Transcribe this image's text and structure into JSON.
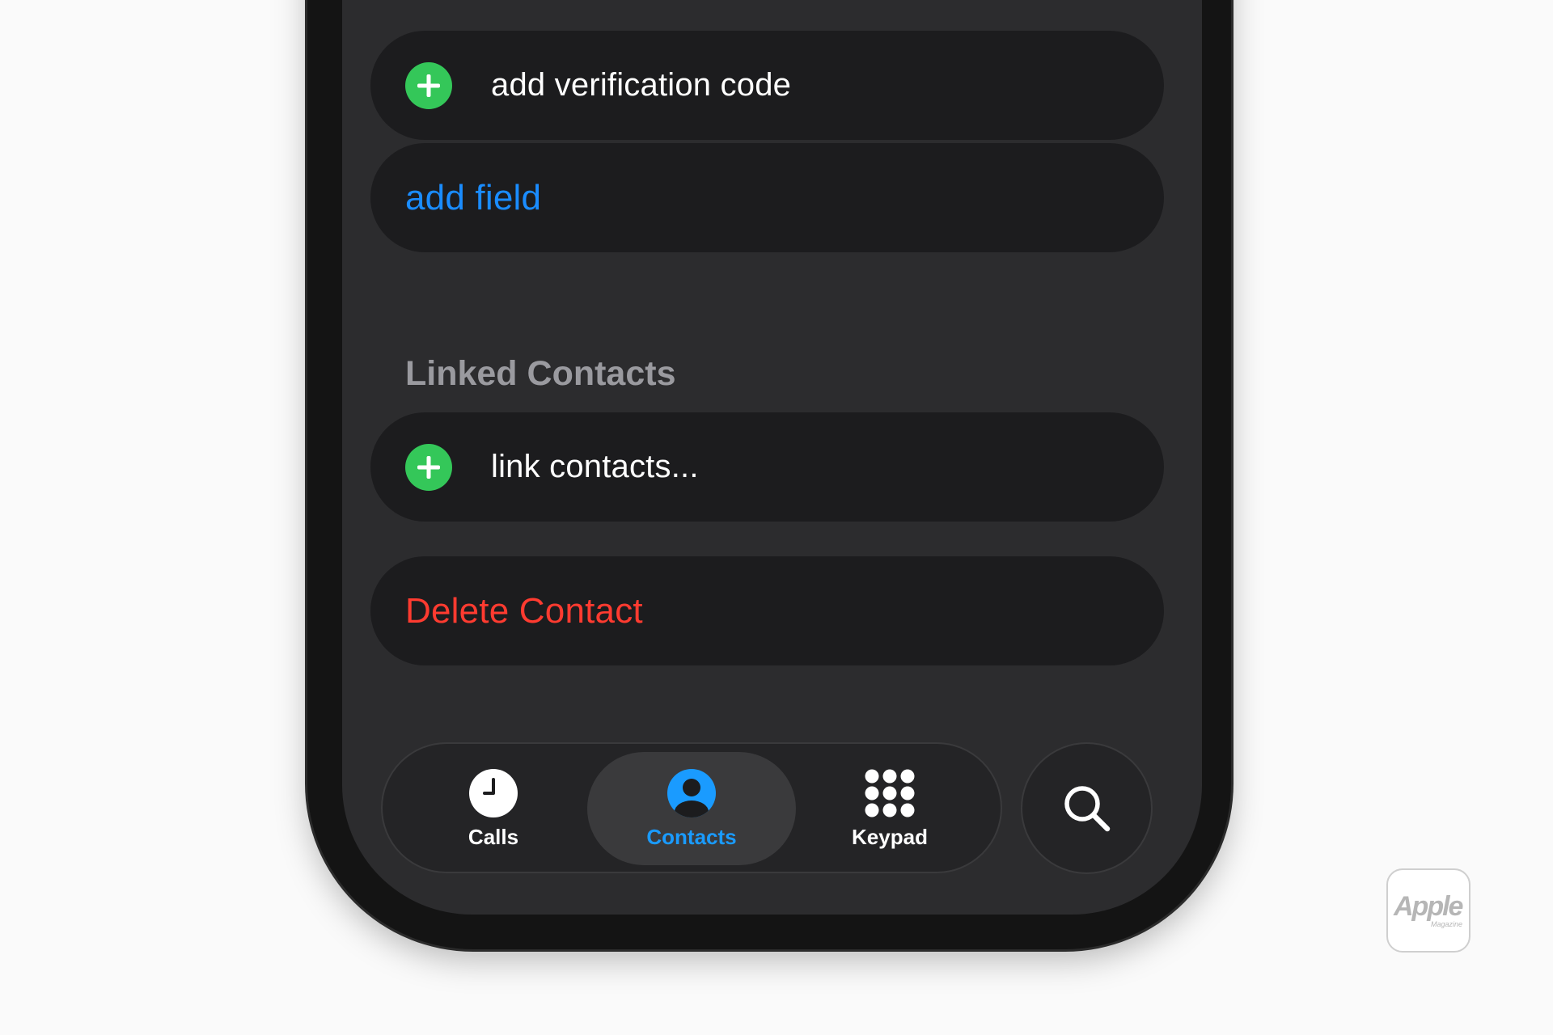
{
  "rows": {
    "verification": {
      "label": "add verification code",
      "icon": "plus-circle-icon"
    },
    "add_field": {
      "label": "add field",
      "color": "#1a8cff"
    },
    "linked_contacts_header": "Linked Contacts",
    "link_contacts": {
      "label": "link contacts...",
      "icon": "plus-circle-icon"
    },
    "delete_contact": {
      "label": "Delete Contact",
      "color": "#ff3b30"
    }
  },
  "tabbar": {
    "tabs": [
      {
        "label": "Calls",
        "icon": "clock-icon",
        "active": false
      },
      {
        "label": "Contacts",
        "icon": "person-icon",
        "active": true
      },
      {
        "label": "Keypad",
        "icon": "keypad-icon",
        "active": false
      }
    ],
    "search_icon": "search-icon"
  },
  "watermark": {
    "text": "Apple",
    "subtext": "Magazine"
  },
  "colors": {
    "accent_blue": "#1a8cff",
    "destructive_red": "#ff3b30",
    "add_green": "#34c759",
    "row_bg": "#1c1c1e",
    "screen_bg": "#2c2c2e"
  }
}
